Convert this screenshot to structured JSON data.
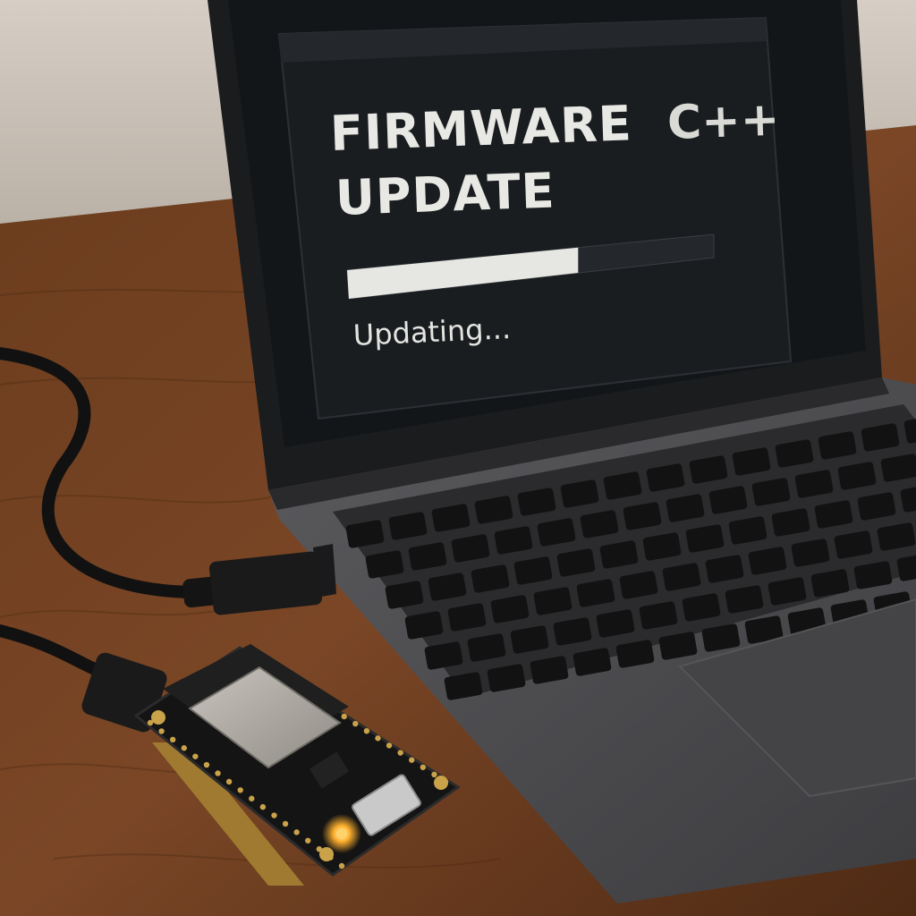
{
  "screen": {
    "title_line_1": "FIRMWARE",
    "title_line_2": "UPDATE",
    "language_mark": "C++",
    "status": "Updating...",
    "progress_fraction": 0.63
  },
  "scene": {
    "objects": [
      "laptop",
      "keyboard-icon",
      "usb-cable-icon",
      "microcontroller-board",
      "status-led-icon"
    ]
  },
  "colors": {
    "wood": "#6b3d1f",
    "wall": "#cfc7bd",
    "screen_bg": "#15181b",
    "progress_fill": "#e6e6e2",
    "laptop_body": "#4a4a4c",
    "led": "#ffb02e"
  }
}
